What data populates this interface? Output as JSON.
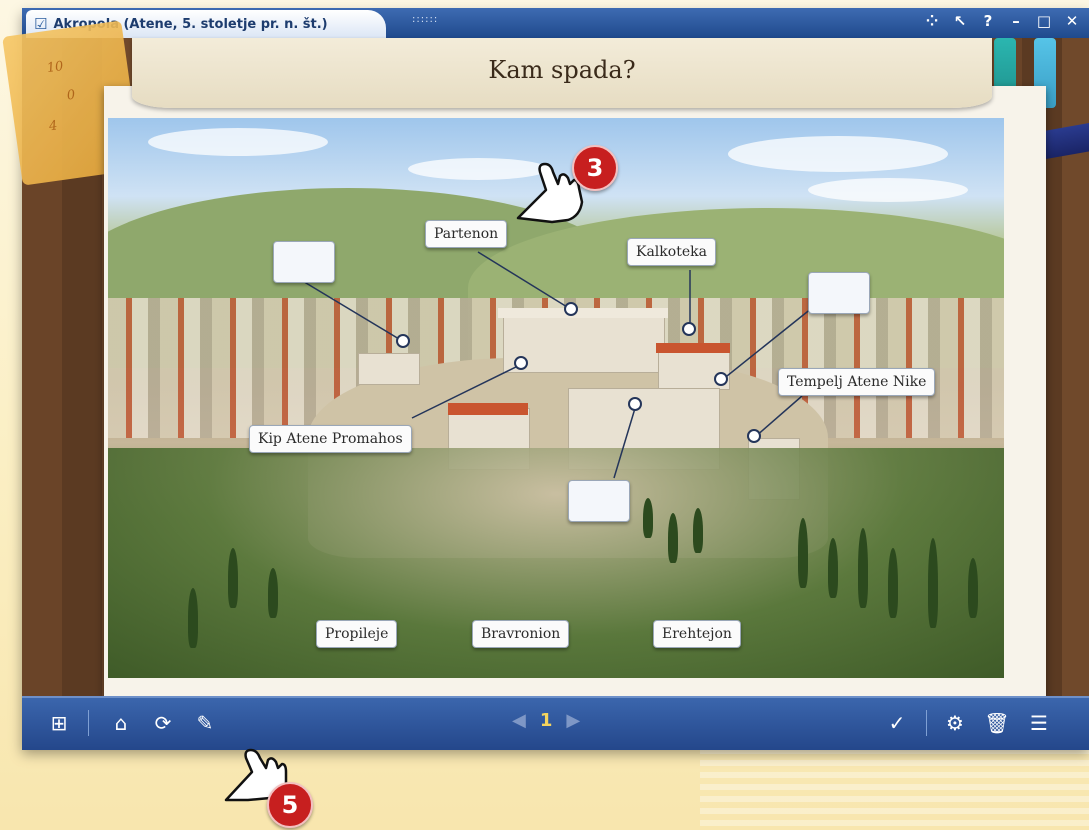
{
  "window": {
    "title": "Akropola (Atene, 5. stoletje pr. n. št.)",
    "dots": "::::::"
  },
  "header": {
    "title": "Kam spada?"
  },
  "labels": {
    "partenon": "Partenon",
    "kalkoteka": "Kalkoteka",
    "tempelj": "Tempelj Atene Nike",
    "kip": "Kip Atene Promahos"
  },
  "word_bank": [
    "Propileje",
    "Bravronion",
    "Erehtejon"
  ],
  "pager": {
    "page": "1"
  },
  "callouts": {
    "top": "3",
    "bottom": "5"
  },
  "colors": {
    "title_bar": "#1f4a8d",
    "badge": "#c71f1f",
    "page_number": "#f5d45e"
  },
  "icons": {
    "title_icon": "clipboard-check-icon",
    "window_controls": [
      "share-icon",
      "pointer-icon",
      "help-icon",
      "minimize-icon",
      "maximize-icon",
      "close-icon"
    ],
    "toolbar_left": [
      "add-page-icon",
      "home-icon",
      "refresh-icon",
      "edit-icon"
    ],
    "toolbar_right": [
      "check-icon",
      "settings-icon",
      "trash-icon",
      "list-icon"
    ]
  }
}
